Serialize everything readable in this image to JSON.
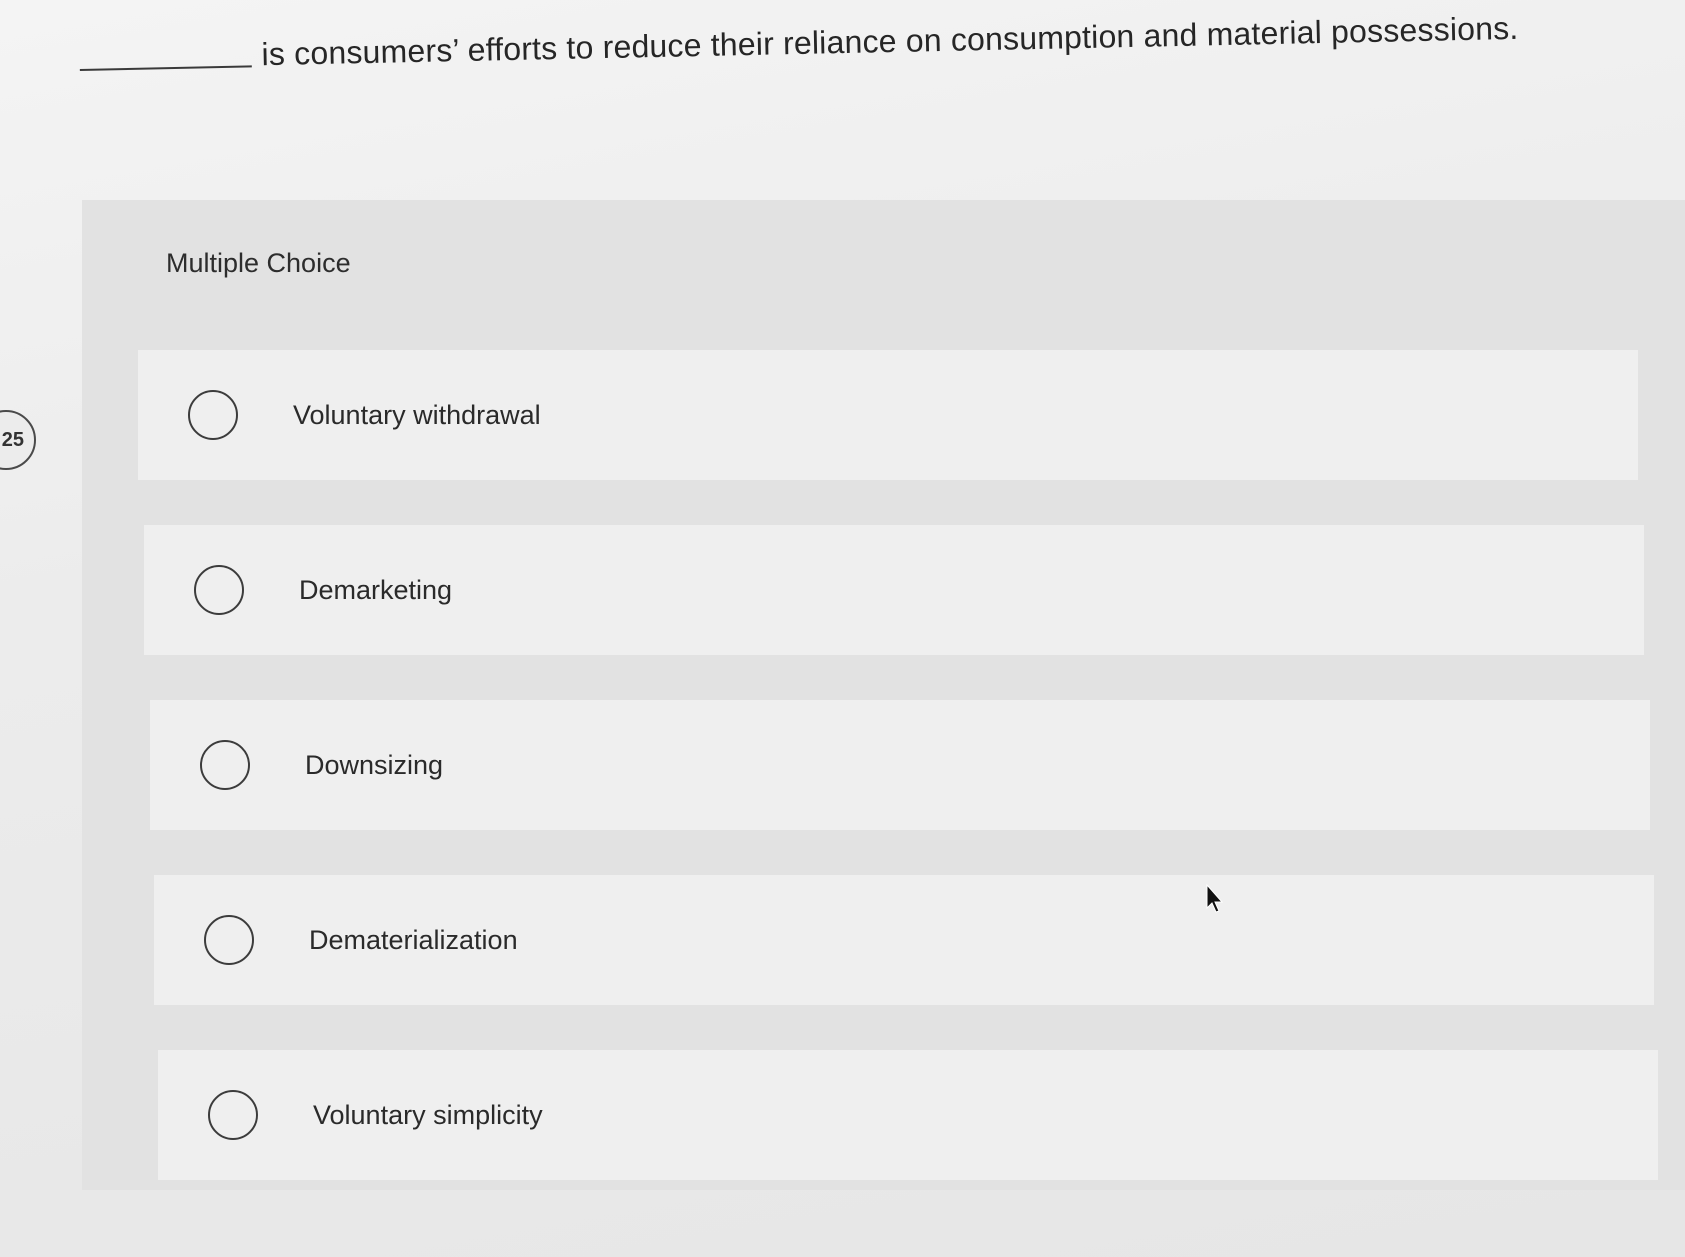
{
  "question": {
    "blank": "",
    "text": "is consumers’ efforts to reduce their reliance on consumption and material possessions."
  },
  "question_number": "25",
  "section_label": "Multiple Choice",
  "options": [
    {
      "label": "Voluntary withdrawal",
      "selected": false
    },
    {
      "label": "Demarketing",
      "selected": false
    },
    {
      "label": "Downsizing",
      "selected": false
    },
    {
      "label": "Dematerialization",
      "selected": false
    },
    {
      "label": "Voluntary simplicity",
      "selected": false
    }
  ],
  "icons": {
    "cursor": "mouse-pointer-icon",
    "radio": "radio-unchecked-icon"
  }
}
